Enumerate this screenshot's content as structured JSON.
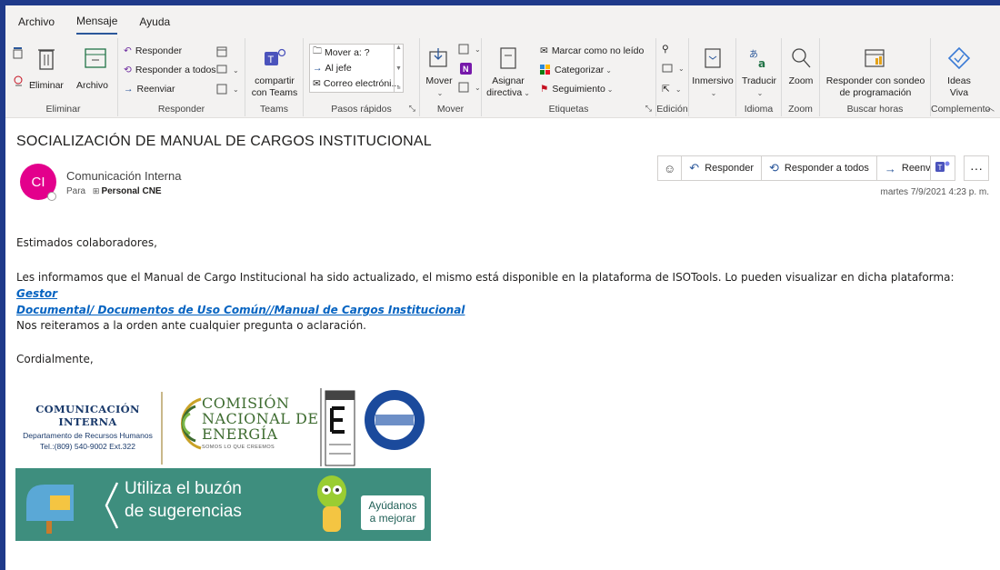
{
  "tabs": [
    "Archivo",
    "Mensaje",
    "Ayuda"
  ],
  "ribbon": {
    "eliminar": {
      "delete_label": "Eliminar",
      "archive_label": "Archivo",
      "group": "Eliminar"
    },
    "responder": {
      "reply": "Responder",
      "reply_all": "Responder a todos",
      "forward": "Reenviar",
      "group": "Responder"
    },
    "teams": {
      "share_line1": "compartir",
      "share_line2": "con Teams",
      "group": "Teams"
    },
    "pasos": {
      "items": [
        "Mover a: ?",
        "Al jefe",
        "Correo electróni..."
      ],
      "group": "Pasos rápidos"
    },
    "mover": {
      "move": "Mover",
      "group": "Mover"
    },
    "etiquetas": {
      "assign_line1": "Asignar",
      "assign_line2": "directiva",
      "mark_unread": "Marcar como no leído",
      "categorize": "Categorizar",
      "followup": "Seguimiento",
      "group": "Etiquetas"
    },
    "edicion": {
      "group": "Edición"
    },
    "inmersivo": {
      "label": "Inmersivo"
    },
    "idioma": {
      "translate": "Traducir",
      "group": "Idioma"
    },
    "zoom": {
      "label": "Zoom",
      "group": "Zoom"
    },
    "buscar_horas": {
      "line1": "Responder con sondeo",
      "line2": "de programación",
      "group": "Buscar horas"
    },
    "complementos": {
      "line1": "Ideas",
      "line2": "Viva",
      "group": "Complemento"
    }
  },
  "message": {
    "subject": "SOCIALIZACIÓN DE MANUAL DE CARGOS INSTITUCIONAL",
    "avatar_initials": "CI",
    "sender": "Comunicación Interna",
    "to_label": "Para",
    "to_value": "Personal CNE",
    "actions": {
      "reply": "Responder",
      "reply_all": "Responder a todos",
      "forward": "Reenviar"
    },
    "date": "martes 7/9/2021 4:23 p. m.",
    "greeting": "Estimados colaboradores,",
    "para1": "Les informamos que el Manual de Cargo Institucional ha sido actualizado, el mismo está disponible en la plataforma de ISOTools. Lo pueden visualizar en dicha plataforma: ",
    "link1": "Gestor",
    "link2": "Documental/ Documentos de Uso Común//Manual de Cargos Institucional",
    "para2": "Nos reiteramos a la orden ante cualquier pregunta o aclaración.",
    "closing": "Cordialmente,"
  },
  "signature": {
    "ci_title": "COMUNICACIÓN INTERNA",
    "ci_dept": "Departamento de Recursos Humanos",
    "ci_tel": "Tel.:(809) 540-9002 Ext.322",
    "cne_line1": "COMISIÓN",
    "cne_line2": "NACIONAL DE",
    "cne_line3": "ENERGÍA",
    "cne_tagline": "SOMOS LO QUE CREEMOS",
    "banner_line1": "Utiliza el buzón",
    "banner_line2": "de sugerencias",
    "banner_help1": "Ayúdanos",
    "banner_help2": "a mejorar"
  },
  "colors": {
    "accent": "#2b579a",
    "avatar": "#e3008c",
    "link": "#0563c1",
    "frame": "#1f3a8a"
  }
}
